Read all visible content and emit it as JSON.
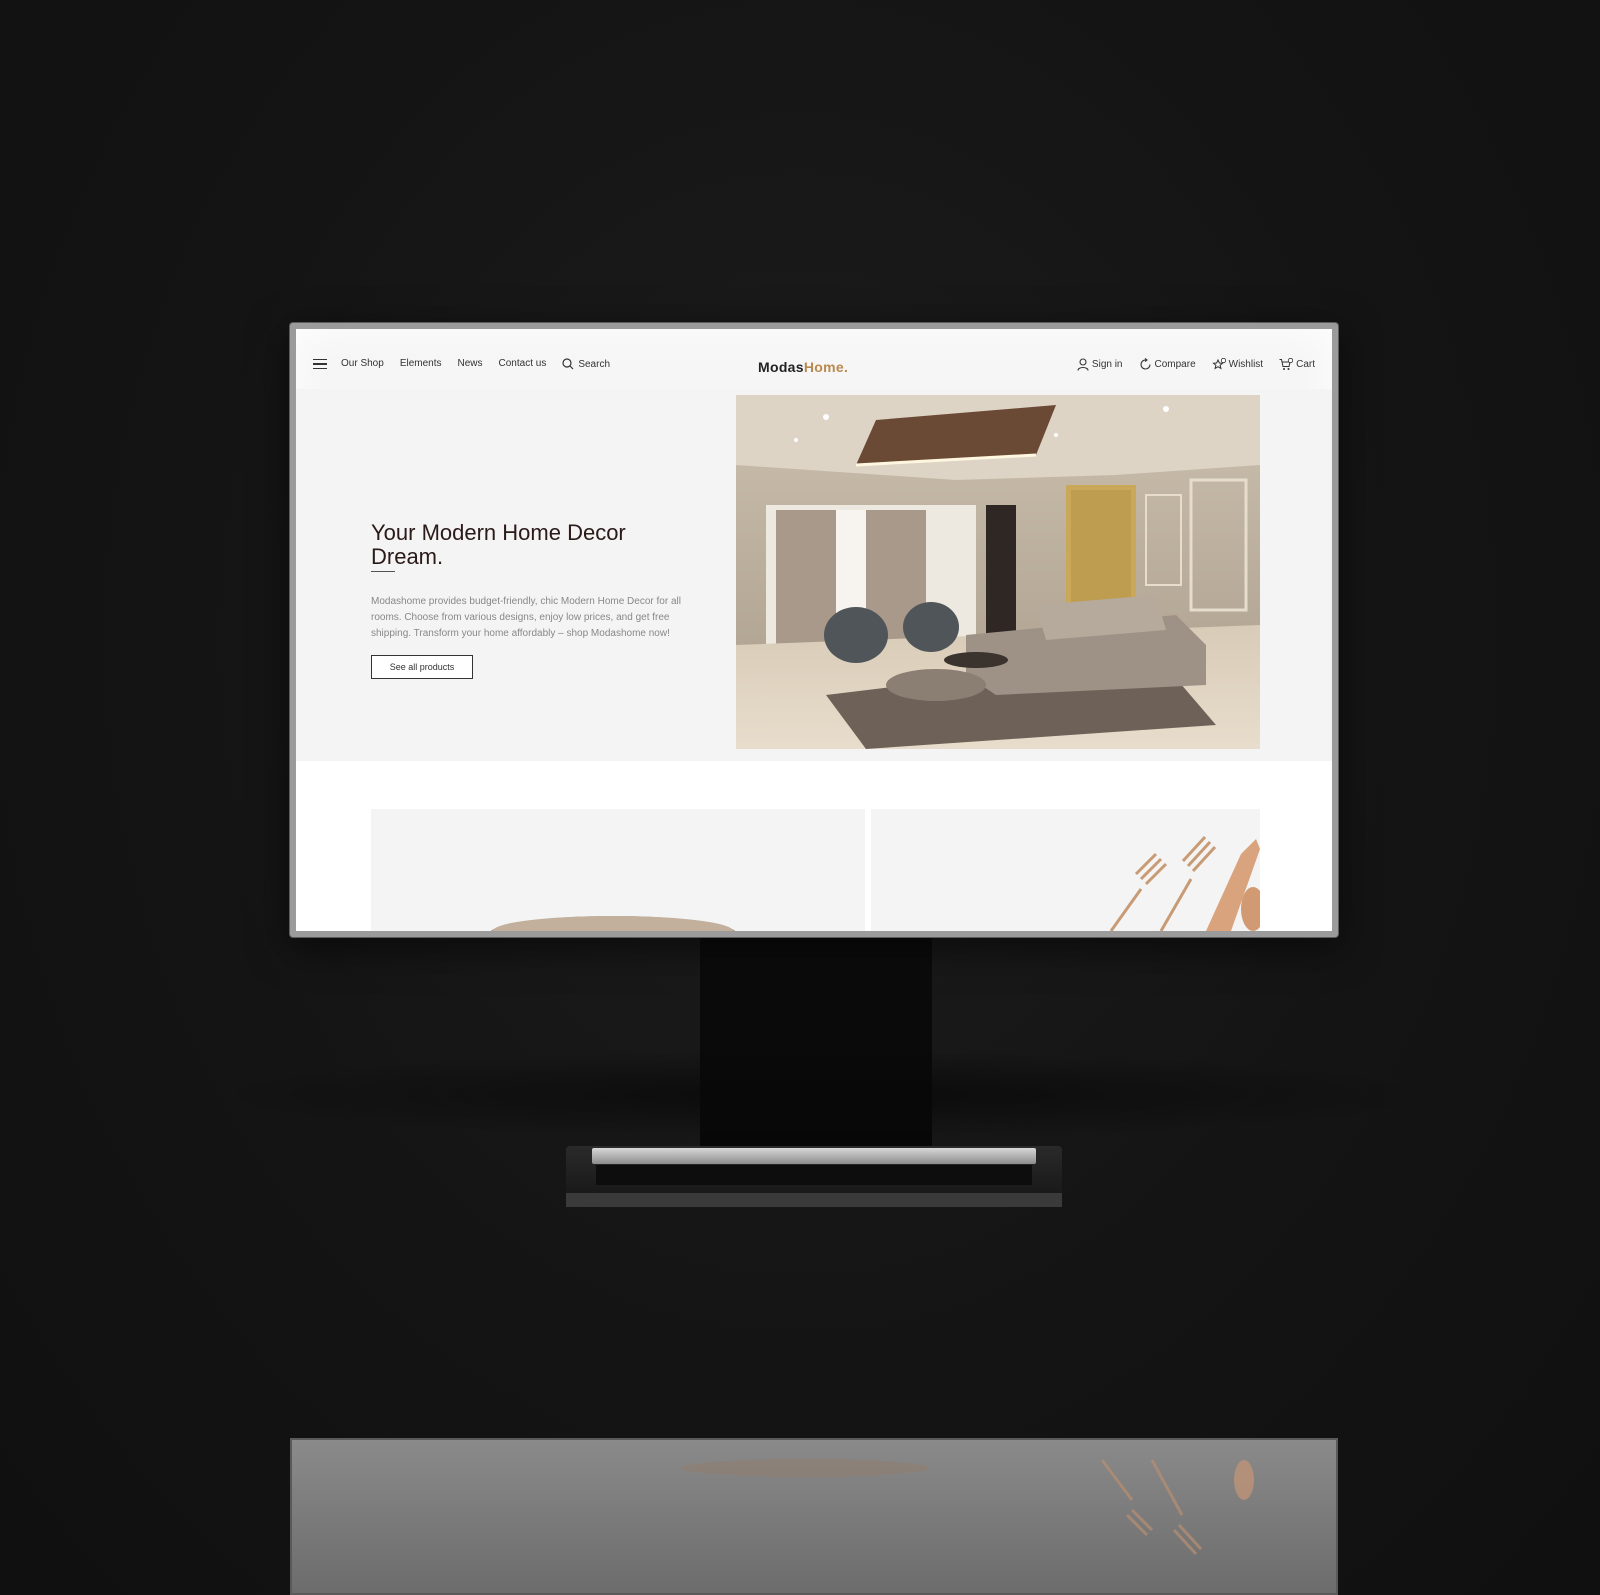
{
  "navbar": {
    "links": [
      "Our Shop",
      "Elements",
      "News",
      "Contact us"
    ],
    "search_label": "Search",
    "logo_primary": "Modas",
    "logo_accent": "Home",
    "logo_dot": ".",
    "sign_in": "Sign in",
    "compare": "Compare",
    "wishlist": "Wishlist",
    "wishlist_count": "0",
    "cart": "Cart",
    "cart_count": "0"
  },
  "hero": {
    "title": "Your Modern Home Decor Dream.",
    "description": "Modashome provides budget-friendly, chic Modern Home Decor for all rooms. Choose from various designs, enjoy low prices, and get free shipping. Transform your home affordably – shop Modashome now!",
    "button_label": "See all products"
  },
  "colors": {
    "accent": "#b98a4f",
    "title": "#2a1a18",
    "background": "#131313"
  }
}
